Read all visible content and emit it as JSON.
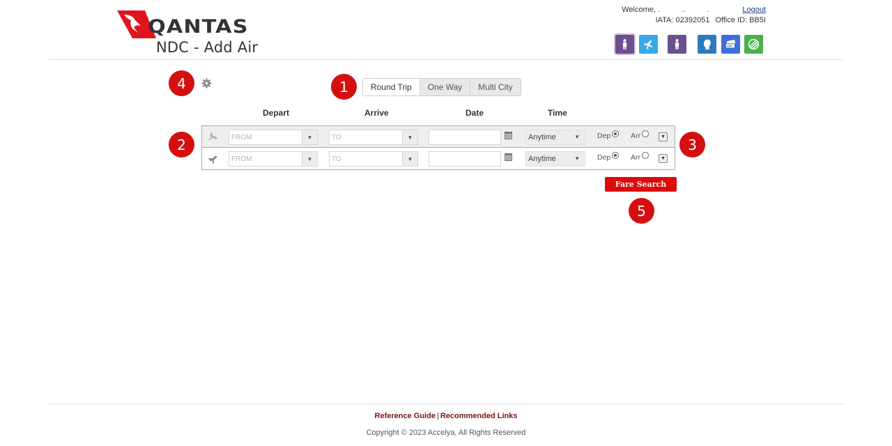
{
  "header": {
    "brand": "QANTAS",
    "page_title": "NDC - Add Air",
    "welcome": "Welcome, .          ..          .",
    "logout": "Logout",
    "iata": "IATA: 02392051",
    "office_id": "Office ID: BB5I",
    "icons": [
      {
        "name": "person-icon",
        "color": "#6c4f8f",
        "selected": true
      },
      {
        "name": "plane-icon",
        "color": "#38a8e8",
        "selected": false
      },
      {
        "name": "person-icon",
        "color": "#6c4f8f",
        "selected": false
      },
      {
        "name": "head-profile-icon",
        "color": "#2a7bbd",
        "selected": false
      },
      {
        "name": "tickets-icon",
        "color": "#3e6fd8",
        "selected": false
      },
      {
        "name": "globe-icon",
        "color": "#49b04a",
        "selected": false
      }
    ]
  },
  "markers": [
    "1",
    "2",
    "3",
    "4",
    "5"
  ],
  "trip_types": [
    {
      "label": "Round Trip",
      "active": true
    },
    {
      "label": "One Way",
      "active": false
    },
    {
      "label": "Multi City",
      "active": false
    }
  ],
  "columns": {
    "depart": "Depart",
    "arrive": "Arrive",
    "date": "Date",
    "time": "Time"
  },
  "rows": [
    {
      "from_placeholder": "FROM",
      "to_placeholder": "TO",
      "date": "",
      "time": "Anytime",
      "dep_label": "Dep",
      "arr_label": "Arr",
      "selected": "Dep"
    },
    {
      "from_placeholder": "FROM",
      "to_placeholder": "TO",
      "date": "",
      "time": "Anytime",
      "dep_label": "Dep",
      "arr_label": "Arr",
      "selected": "Dep"
    }
  ],
  "fare_search": "Fare Search",
  "footer": {
    "reference_guide": "Reference Guide",
    "separator": "|",
    "recommended_links": "Recommended Links",
    "copyright": "Copyright © 2023 Accelya, All Rights Reserved"
  },
  "colors": {
    "brand_red": "#dd0a0a",
    "marker_red": "#d50f0f",
    "footer_link": "#7c1212"
  }
}
